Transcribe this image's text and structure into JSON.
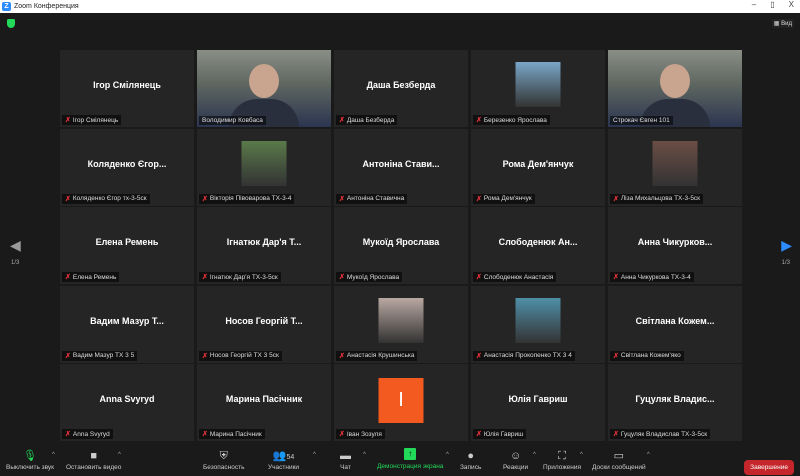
{
  "window": {
    "title": "Zoom Конференция",
    "minimize": "–",
    "maximize": "▯",
    "close": "X"
  },
  "view_button": "▦ Вид",
  "pagination": {
    "left": "1/3",
    "right": "1/3"
  },
  "tiles": [
    {
      "name": "Ігор Смілянець",
      "label": "Ігор Смілянець",
      "type": "name"
    },
    {
      "label": "Володимир Ковбаса",
      "type": "video"
    },
    {
      "name": "Даша Безберда",
      "label": "Даша Безберда",
      "type": "name"
    },
    {
      "label": "Березенко Ярослава",
      "type": "photo",
      "photo": "#7aa6c8"
    },
    {
      "label": "Строкач Євген 101",
      "type": "video",
      "active": true
    },
    {
      "name": "Коляденко Єгор...",
      "label": "Коляденко Єгор тх-3-5ск",
      "type": "name"
    },
    {
      "label": "Вікторія Півоварова ТХ-3-4",
      "type": "photo",
      "photo": "#5a7a4a"
    },
    {
      "name": "Антоніна  Стави...",
      "label": "Антоніна Ставична",
      "type": "name"
    },
    {
      "name": "Рома Дем'янчук",
      "label": "Рома Дем'янчук",
      "type": "name"
    },
    {
      "label": "Ліза Михальцова ТХ-3-5ск",
      "type": "photo",
      "photo": "#6b4e45"
    },
    {
      "name": "Елена Ремень",
      "label": "Елена Ремень",
      "type": "name"
    },
    {
      "name": "Ігнатюк Дар'я Т...",
      "label": "Ігнатюк Дар'я ТХ-3-5ск",
      "type": "name"
    },
    {
      "name": "Мукоїд Ярослава",
      "label": "Мукоїд Ярослава",
      "type": "name"
    },
    {
      "name": "Слободенюк  Ан...",
      "label": "Слободенюк Анастасія",
      "type": "name"
    },
    {
      "name": "Анна  Чикурков...",
      "label": "Анна Чикуркова ТХ-3-4",
      "type": "name"
    },
    {
      "name": "Вадим Мазур Т...",
      "label": "Вадим Мазур ТХ 3 5",
      "type": "name"
    },
    {
      "name": "Носов  Георгій Т...",
      "label": "Носов Георгій ТХ 3 5ск",
      "type": "name"
    },
    {
      "label": "Анастасія Крушинська",
      "type": "photo",
      "photo": "#b9a8a2"
    },
    {
      "label": "Анастасія Прокопенко ТХ 3 4",
      "type": "photo",
      "photo": "#4f8fa8"
    },
    {
      "name": "Світлана  Кожем...",
      "label": "Світлана Кожем'яко",
      "type": "name"
    },
    {
      "name": "Anna Svyryd",
      "label": "Anna Svyryd",
      "type": "name"
    },
    {
      "name": "Марина Пасічник",
      "label": "Марина Пасічник",
      "type": "name"
    },
    {
      "label": "Іван Зозуля",
      "type": "letter",
      "letter": "I"
    },
    {
      "name": "Юлія Гавриш",
      "label": "Юлія Гавриш",
      "type": "name"
    },
    {
      "name": "Гуцуляк  Владис...",
      "label": "Гуцуляк Владислав ТХ-3-5ск",
      "type": "name"
    }
  ],
  "toolbar": {
    "mute": "Выключить звук",
    "video": "Остановить видео",
    "security": "Безопасность",
    "participants": "Участники",
    "participants_count": "54",
    "chat": "Чат",
    "share": "Демонстрация экрана",
    "record": "Запись",
    "reactions": "Реакции",
    "apps": "Приложения",
    "whiteboards": "Доски сообщений",
    "end": "Завершение"
  }
}
